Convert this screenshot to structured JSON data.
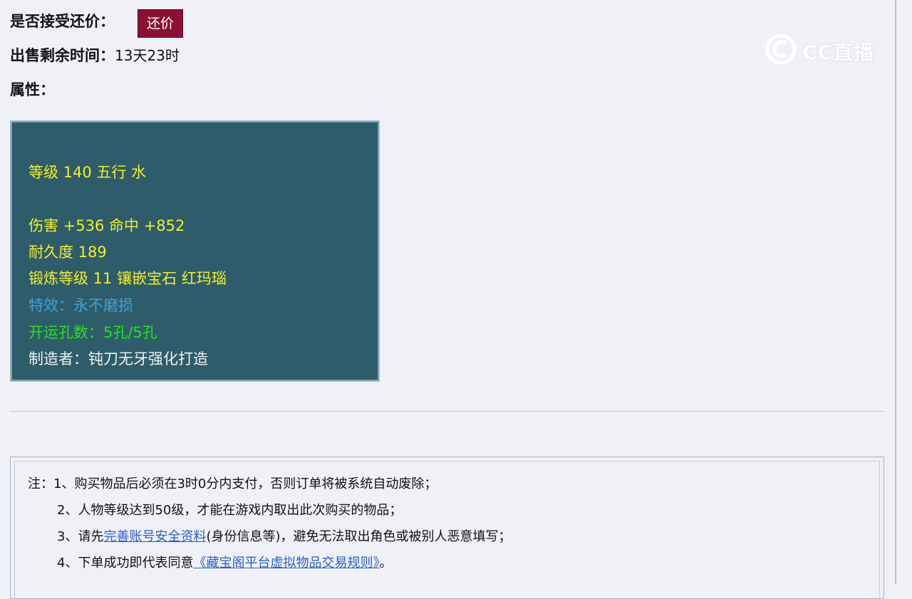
{
  "counter_offer": {
    "label": "是否接受还价：",
    "button_label": "还价"
  },
  "time_remaining": {
    "label": "出售剩余时间：",
    "value": "13天23时"
  },
  "attributes": {
    "label": "属性：",
    "lines": {
      "level_element": "等级 140 五行 水",
      "damage_hit": "伤害 +536 命中 +852",
      "durability": "耐久度 189",
      "forging": "锻炼等级 11 镶嵌宝石 红玛瑙",
      "special_effect": "特效：永不磨损",
      "lucky_holes": "开运孔数：5孔/5孔",
      "maker": "制造者：钝刀无牙强化打造"
    }
  },
  "notice": {
    "prefix": "注：",
    "item1": "1、购买物品后必须在3时0分内支付，否则订单将被系统自动废除；",
    "item2": "2、人物等级达到50级，才能在游戏内取出此次购买的物品；",
    "item3_before": "3、请先",
    "item3_link": "完善账号安全资料",
    "item3_after": "(身份信息等)，避免无法取出角色或被别人恶意填写；",
    "item4_before": "4、下单成功即代表同意",
    "item4_link": "《藏宝阁平台虚拟物品交易规则》",
    "item4_after": "。"
  },
  "watermark": {
    "text": "CC直播",
    "icon": "cc-logo-icon"
  },
  "colors": {
    "button_bg": "#8a1034",
    "panel_bg": "#2f5c6b",
    "text_yellow": "#f2ef2a",
    "text_blue": "#3fa2d8",
    "text_green": "#28e01e",
    "link": "#2860c8"
  }
}
